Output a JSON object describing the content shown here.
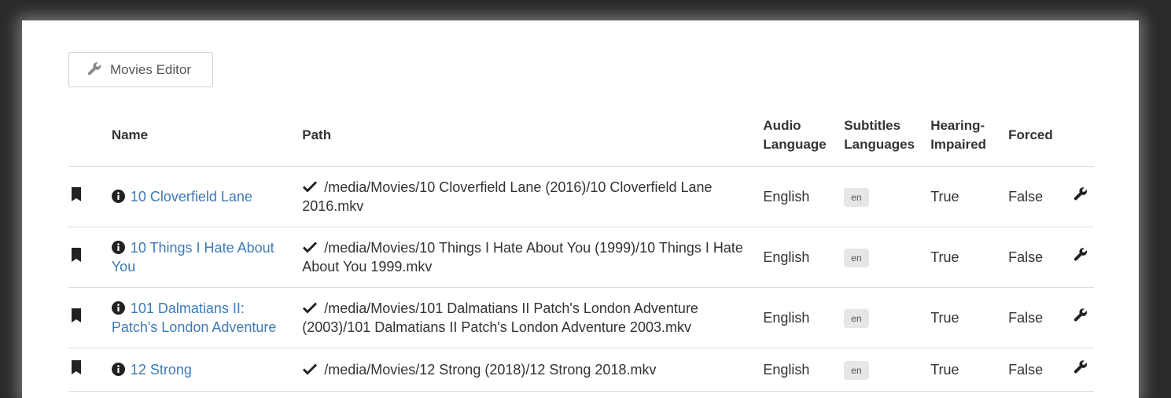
{
  "toolbar": {
    "movies_editor_label": "Movies Editor",
    "icon": "wrench-icon"
  },
  "table": {
    "headers": {
      "name": "Name",
      "path": "Path",
      "audio_language": "Audio Language",
      "subtitles_languages": "Subtitles Languages",
      "hearing_impaired": "Hearing-Impaired",
      "forced": "Forced"
    },
    "rows": [
      {
        "name": "10 Cloverfield Lane",
        "path": "/media/Movies/10 Cloverfield Lane (2016)/10 Cloverfield Lane 2016.mkv",
        "audio_language": "English",
        "subtitles": "en",
        "hearing_impaired": "True",
        "forced": "False"
      },
      {
        "name": "10 Things I Hate About You",
        "path": "/media/Movies/10 Things I Hate About You (1999)/10 Things I Hate About You 1999.mkv",
        "audio_language": "English",
        "subtitles": "en",
        "hearing_impaired": "True",
        "forced": "False"
      },
      {
        "name": "101 Dalmatians II: Patch's London Adventure",
        "path": "/media/Movies/101 Dalmatians II Patch's London Adventure (2003)/101 Dalmatians II Patch's London Adventure 2003.mkv",
        "audio_language": "English",
        "subtitles": "en",
        "hearing_impaired": "True",
        "forced": "False"
      },
      {
        "name": "12 Strong",
        "path": "/media/Movies/12 Strong (2018)/12 Strong 2018.mkv",
        "audio_language": "English",
        "subtitles": "en",
        "hearing_impaired": "True",
        "forced": "False"
      }
    ]
  },
  "colors": {
    "link": "#3d7ab8",
    "text": "#333333",
    "badge_bg": "#e6e6e6",
    "backdrop": "#2a2a2a"
  }
}
